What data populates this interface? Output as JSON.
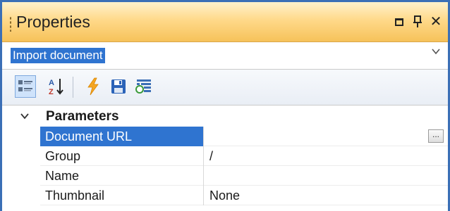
{
  "window": {
    "title": "Properties",
    "buttons": {
      "dropdown_icon": "window-position-icon",
      "pin_icon": "pin-icon",
      "close_icon": "close-icon",
      "close_glyph": "✕",
      "pin_glyph": "⩩"
    }
  },
  "object_selector": {
    "value": "Import document"
  },
  "toolbar": {
    "buttons": [
      {
        "name": "categorized-view",
        "icon": "categorized-icon",
        "pressed": true
      },
      {
        "name": "alphabetical-sort",
        "icon": "sort-az-icon",
        "pressed": false
      },
      {
        "name": "events",
        "icon": "lightning-icon",
        "pressed": false
      },
      {
        "name": "save",
        "icon": "floppy-disk-icon",
        "pressed": false
      },
      {
        "name": "property-pages",
        "icon": "property-pages-icon",
        "pressed": false
      }
    ]
  },
  "grid": {
    "category": {
      "label": "Parameters",
      "expanded": true
    },
    "rows": [
      {
        "name": "Document URL",
        "value": "",
        "selected": true,
        "has_ellipsis": true,
        "ellipsis": "..."
      },
      {
        "name": "Group",
        "value": "/",
        "selected": false
      },
      {
        "name": "Name",
        "value": "",
        "selected": false
      },
      {
        "name": "Thumbnail",
        "value": "None",
        "selected": false
      }
    ]
  },
  "colors": {
    "title_gradient_top": "#fff2cc",
    "title_gradient_bottom": "#f6c25a",
    "selection": "#2f74d0",
    "frame_border": "#3b6fb6"
  }
}
